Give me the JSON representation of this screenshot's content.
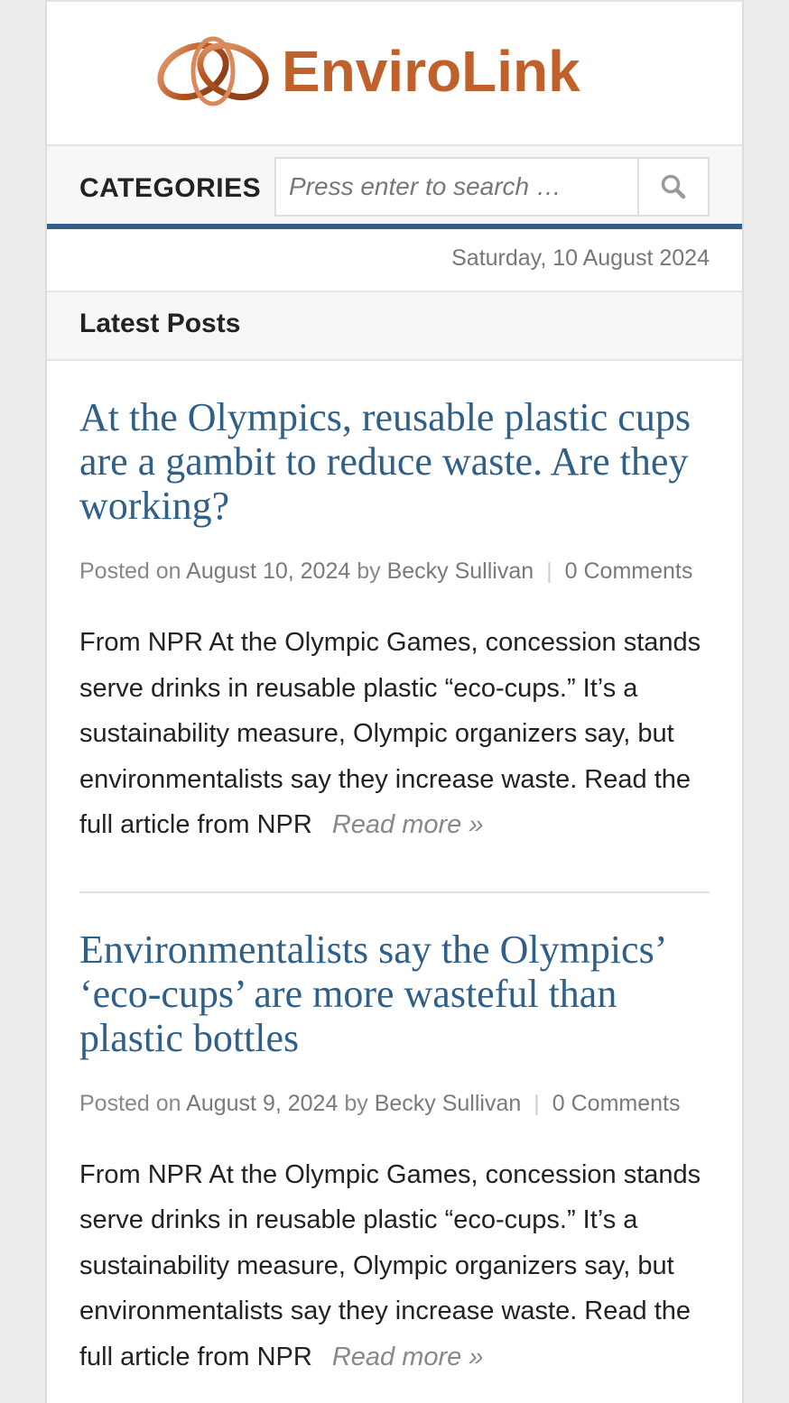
{
  "header": {
    "logo_text": "EnviroLink",
    "brand_color": "#c0602a"
  },
  "nav": {
    "categories_label": "CATEGORIES",
    "search_placeholder": "Press enter to search …",
    "search_icon": "search-icon",
    "accent_color": "#32608a"
  },
  "date": "Saturday, 10 August 2024",
  "section": {
    "title": "Latest Posts"
  },
  "posts": [
    {
      "title": "At the Olympics, reusable plastic cups are a gambit to reduce waste. Are they working?",
      "posted_on": "Posted on",
      "date": "August 10, 2024",
      "by": "by",
      "author": "Becky Sullivan",
      "comments": "0 Comments",
      "excerpt": "From NPR At the Olympic Games, concession stands serve drinks in reusable plastic “eco-cups.” It’s a sustainability measure, Olympic organizers say, but environmentalists say they increase waste. Read the full article from NPR",
      "read_more": "Read more »"
    },
    {
      "title": "Environmentalists say the Olympics’ ‘eco-cups’ are more wasteful than plastic bottles",
      "posted_on": "Posted on",
      "date": "August 9, 2024",
      "by": "by",
      "author": "Becky Sullivan",
      "comments": "0 Comments",
      "excerpt": "From NPR At the Olympic Games, concession stands serve drinks in reusable plastic “eco-cups.” It’s a sustainability measure, Olympic organizers say, but environmentalists say they increase waste. Read the full article from NPR",
      "read_more": "Read more »"
    }
  ]
}
